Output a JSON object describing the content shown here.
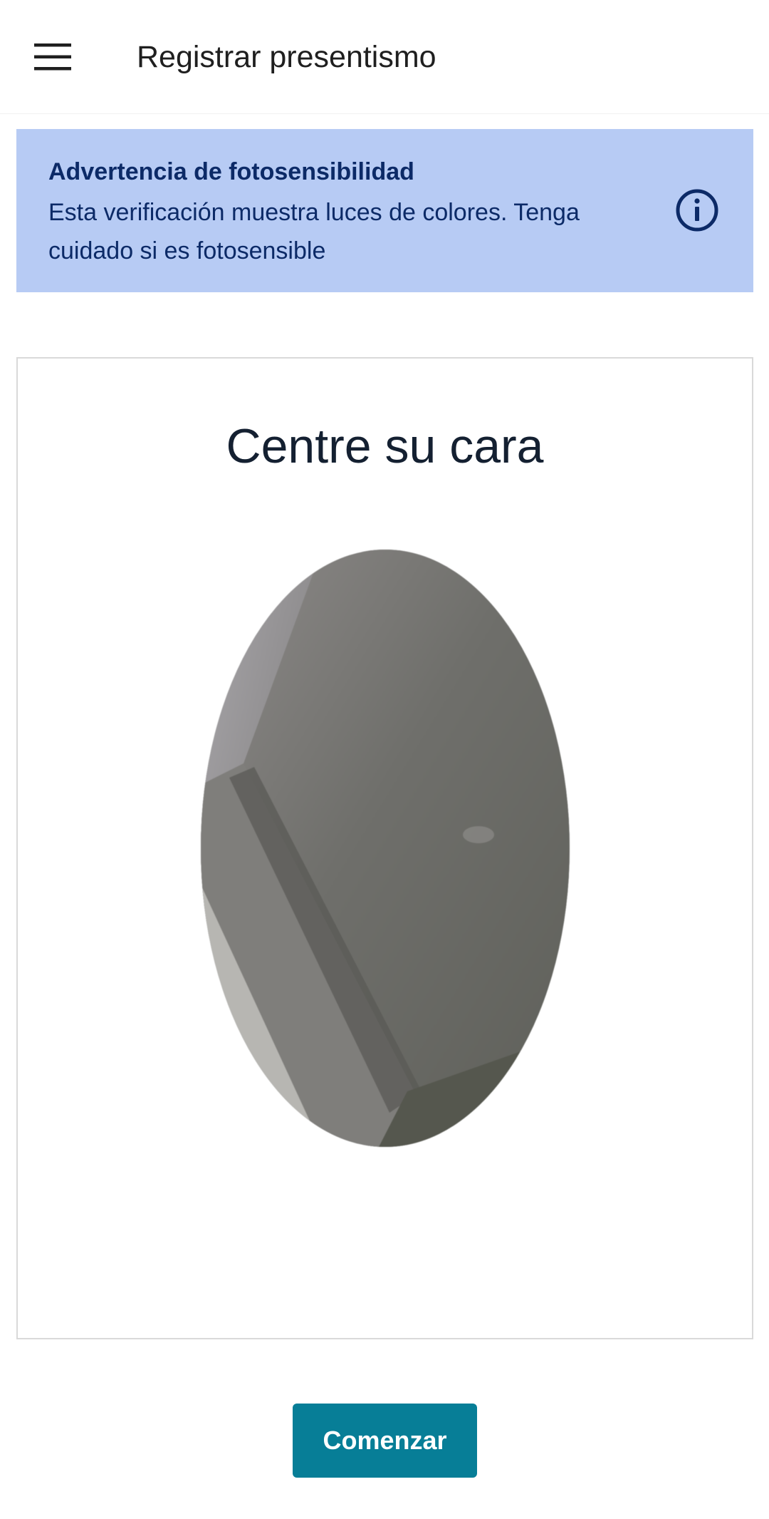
{
  "app_bar": {
    "menu_icon": "hamburger-menu-icon",
    "title": "Registrar presentismo"
  },
  "warning": {
    "title": "Advertencia de fotosensibilidad",
    "message": "Esta verificación muestra luces de colores. Tenga cuidado si es fotosensible",
    "icon": "info-icon"
  },
  "camera": {
    "instruction": "Centre su cara"
  },
  "actions": {
    "start_label": "Comenzar"
  },
  "colors": {
    "banner_background": "#b7cbf4",
    "banner_text": "#0c2a67",
    "primary_button": "#077e97"
  }
}
